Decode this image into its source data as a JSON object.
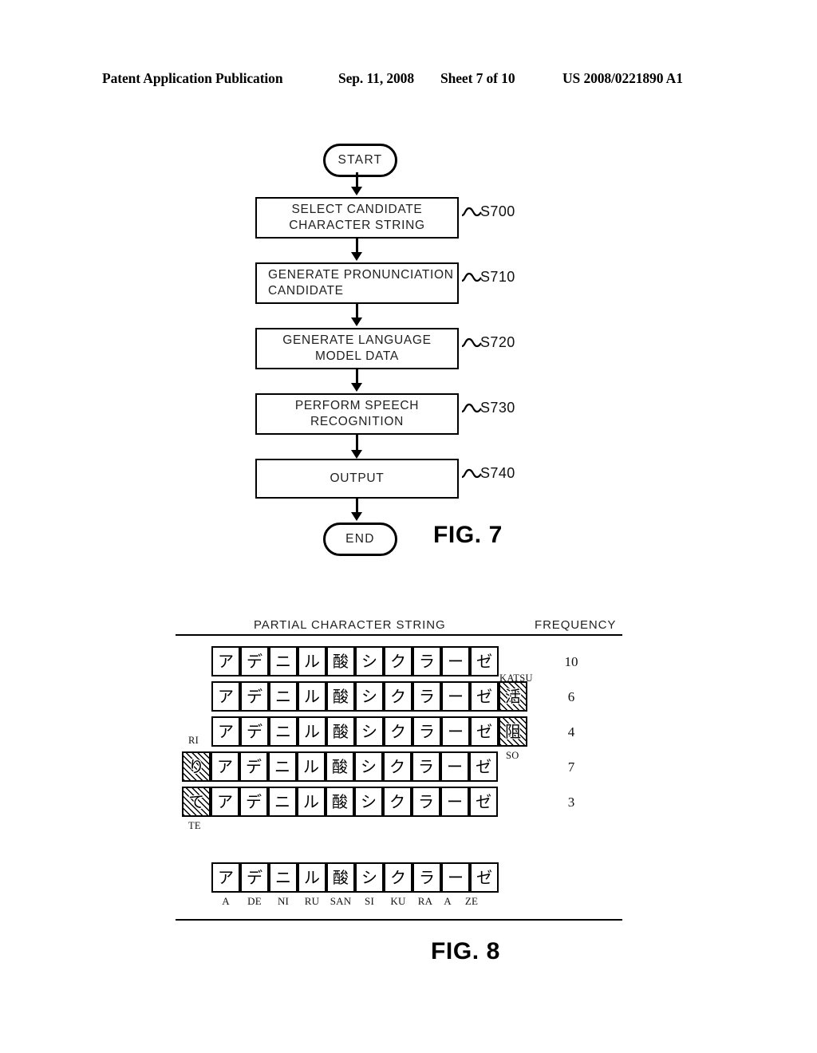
{
  "header": {
    "publication": "Patent Application Publication",
    "date": "Sep. 11, 2008",
    "sheet": "Sheet 7 of 10",
    "patent_number": "US 2008/0221890 A1"
  },
  "figure7": {
    "fig_label": "FIG. 7",
    "start_label": "START",
    "end_label": "END",
    "steps": [
      {
        "text": "SELECT CANDIDATE\nCHARACTER STRING",
        "line1": "SELECT CANDIDATE",
        "line2": "CHARACTER STRING",
        "step_id": "S700",
        "align": "center"
      },
      {
        "text": "GENERATE PRONUNCIATION\nCANDIDATE",
        "line1": "GENERATE PRONUNCIATION",
        "line2": "CANDIDATE",
        "step_id": "S710",
        "align": "left"
      },
      {
        "text": "GENERATE LANGUAGE\nMODEL DATA",
        "line1": "GENERATE LANGUAGE",
        "line2": "MODEL DATA",
        "step_id": "S720",
        "align": "center"
      },
      {
        "text": "PERFORM SPEECH\nRECOGNITION",
        "line1": "PERFORM SPEECH",
        "line2": "RECOGNITION",
        "step_id": "S730",
        "align": "center"
      },
      {
        "text": "OUTPUT",
        "line1": "OUTPUT",
        "line2": "",
        "step_id": "S740",
        "align": "center"
      }
    ]
  },
  "figure8": {
    "fig_label": "FIG. 8",
    "column_headers": {
      "partial_character_string": "PARTIAL CHARACTER STRING",
      "frequency": "FREQUENCY"
    },
    "base_string": [
      "ア",
      "デ",
      "ニ",
      "ル",
      "酸",
      "シ",
      "ク",
      "ラ",
      "ー",
      "ゼ"
    ],
    "rows": [
      {
        "cells": [
          "ア",
          "デ",
          "ニ",
          "ル",
          "酸",
          "シ",
          "ク",
          "ラ",
          "ー",
          "ゼ"
        ],
        "prefix_cell": null,
        "suffix_cell": null,
        "annotation": "KATSU",
        "frequency": "10"
      },
      {
        "cells": [
          "ア",
          "デ",
          "ニ",
          "ル",
          "酸",
          "シ",
          "ク",
          "ラ",
          "ー",
          "ゼ"
        ],
        "prefix_cell": null,
        "suffix_cell": "活",
        "annotation": "",
        "frequency": "6"
      },
      {
        "cells": [
          "ア",
          "デ",
          "ニ",
          "ル",
          "酸",
          "シ",
          "ク",
          "ラ",
          "ー",
          "ゼ"
        ],
        "prefix_cell": null,
        "suffix_cell": "阻",
        "annotation": "RI",
        "annotation2": "SO",
        "frequency": "4"
      },
      {
        "cells": [
          "ア",
          "デ",
          "ニ",
          "ル",
          "酸",
          "シ",
          "ク",
          "ラ",
          "ー",
          "ゼ"
        ],
        "prefix_cell": "り",
        "suffix_cell": null,
        "annotation": "",
        "frequency": "7"
      },
      {
        "cells": [
          "ア",
          "デ",
          "ニ",
          "ル",
          "酸",
          "シ",
          "ク",
          "ラ",
          "ー",
          "ゼ"
        ],
        "prefix_cell": "て",
        "suffix_cell": null,
        "annotation": "TE",
        "frequency": "3"
      }
    ],
    "romanized_row": {
      "cells": [
        "ア",
        "デ",
        "ニ",
        "ル",
        "酸",
        "シ",
        "ク",
        "ラ",
        "ー",
        "ゼ"
      ],
      "romaji": [
        "A",
        "DE",
        "NI",
        "RU",
        "SAN",
        "SI",
        "KU",
        "RA",
        "A",
        "ZE"
      ]
    }
  }
}
